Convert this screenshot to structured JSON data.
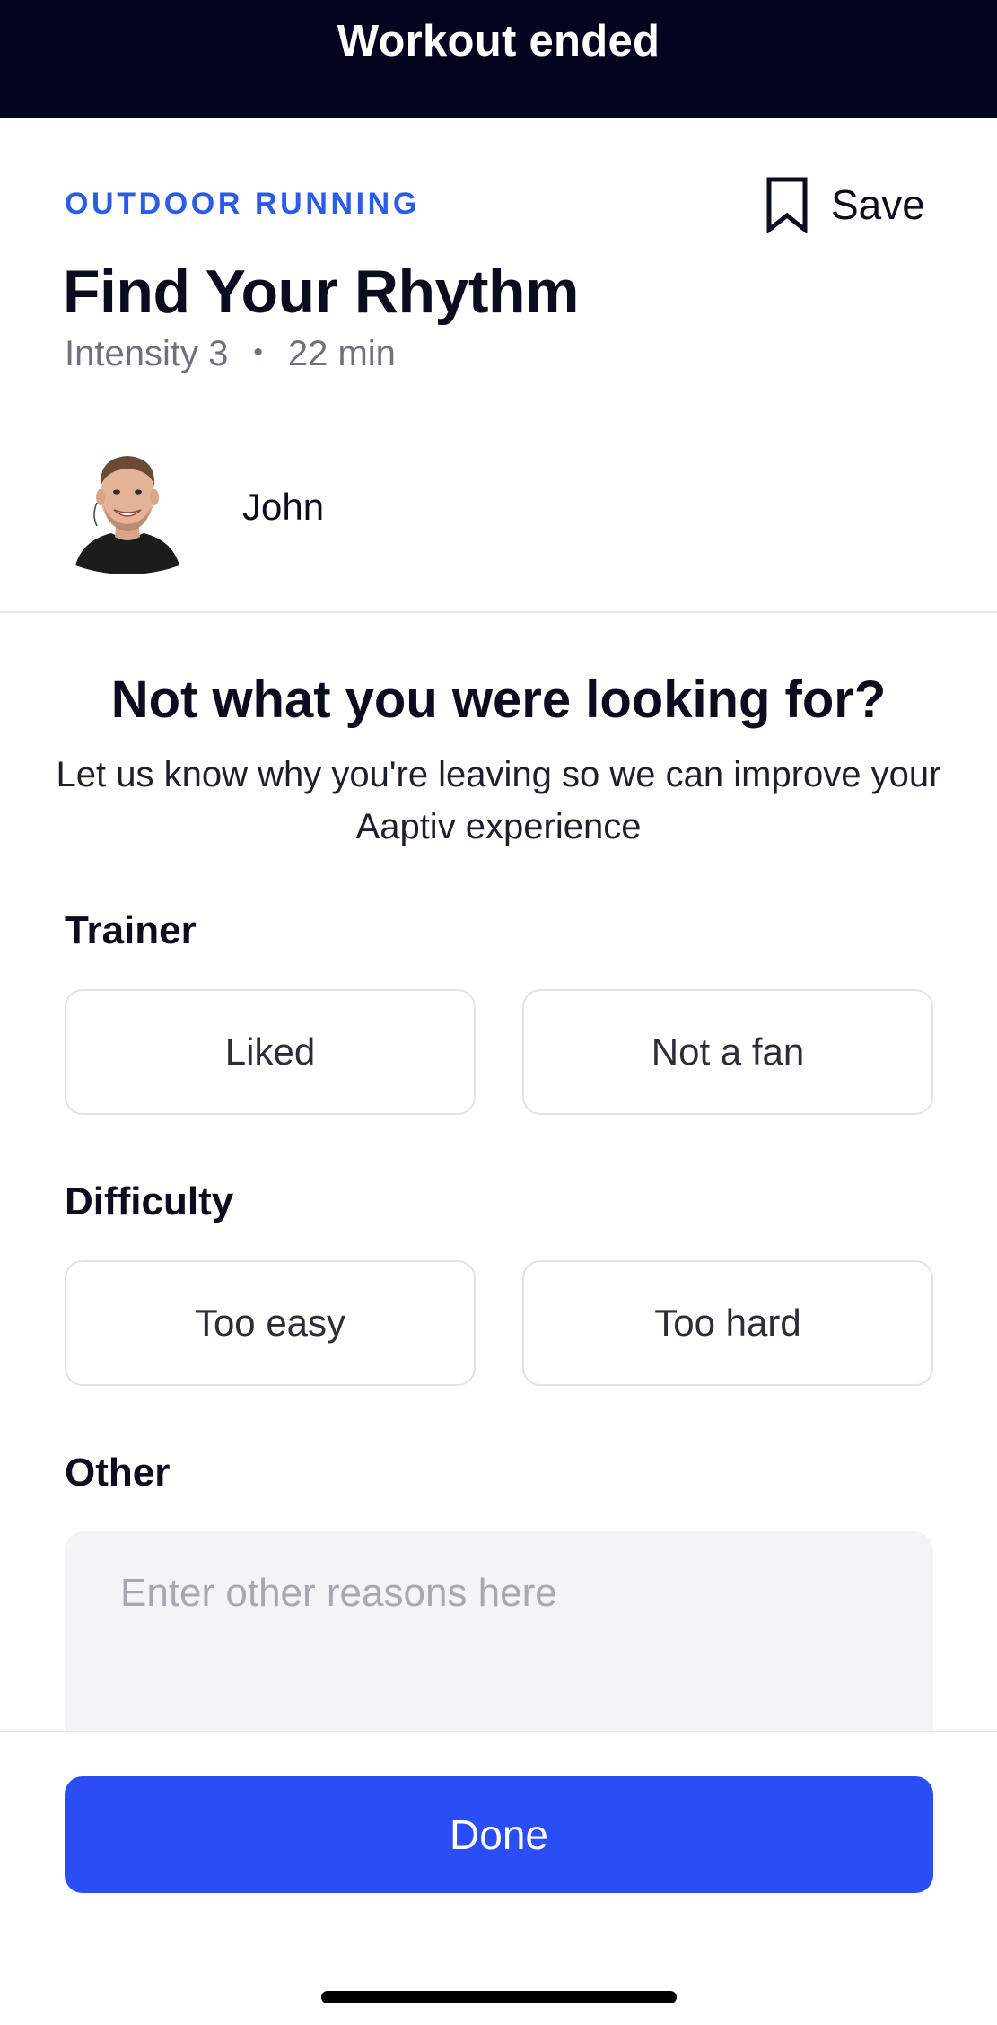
{
  "header": {
    "title": "Workout ended"
  },
  "workout": {
    "category": "OUTDOOR RUNNING",
    "title": "Find Your Rhythm",
    "intensity": "Intensity 3",
    "separator": "•",
    "duration": "22 min",
    "save_label": "Save",
    "save_icon": "bookmark-icon"
  },
  "trainer": {
    "name": "John"
  },
  "feedback": {
    "heading": "Not what you were looking for?",
    "subtitle": "Let us know why you're leaving so we can improve your Aaptiv experience",
    "trainer_section": {
      "label": "Trainer",
      "options": [
        "Liked",
        "Not a fan"
      ]
    },
    "difficulty_section": {
      "label": "Difficulty",
      "options": [
        "Too easy",
        "Too hard"
      ]
    },
    "other_section": {
      "label": "Other",
      "placeholder": "Enter other reasons here",
      "value": ""
    }
  },
  "actions": {
    "done_label": "Done"
  },
  "colors": {
    "header_bg": "#03051f",
    "accent": "#2b5ce6",
    "primary_button": "#2b4df5",
    "input_bg": "#f3f4f6",
    "border": "#e1e3e8"
  }
}
